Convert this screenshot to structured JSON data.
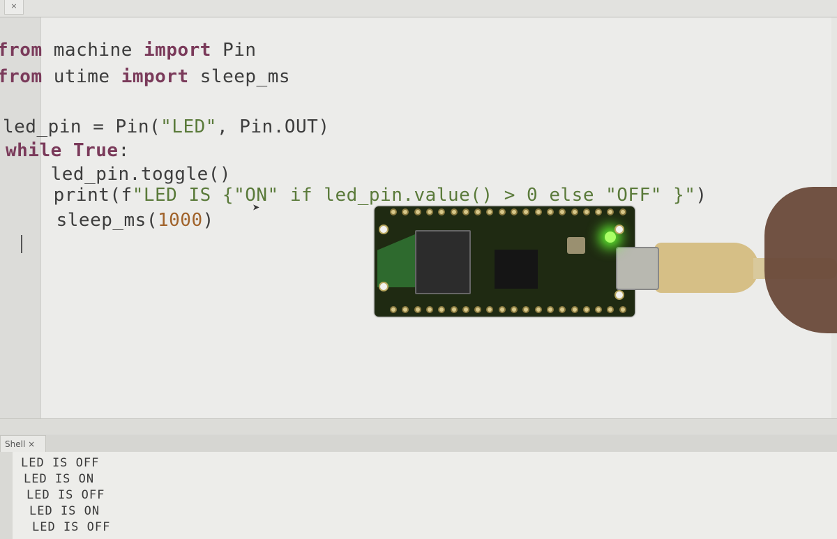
{
  "tabs": {
    "close_glyph": "×"
  },
  "editor": {
    "lines": [
      {
        "parts": [
          {
            "t": "from",
            "c": "kw"
          },
          {
            "t": " machine "
          },
          {
            "t": "import",
            "c": "kw"
          },
          {
            "t": " Pin"
          }
        ]
      },
      {
        "parts": [
          {
            "t": "from",
            "c": "kw"
          },
          {
            "t": " utime "
          },
          {
            "t": "import",
            "c": "kw"
          },
          {
            "t": " sleep_ms"
          }
        ]
      },
      {
        "parts": [
          {
            "t": ""
          }
        ]
      },
      {
        "parts": [
          {
            "t": "led_pin = Pin("
          },
          {
            "t": "\"LED\"",
            "c": "str"
          },
          {
            "t": ", Pin.OUT)"
          }
        ]
      },
      {
        "parts": [
          {
            "t": "while",
            "c": "kw"
          },
          {
            "t": " "
          },
          {
            "t": "True",
            "c": "kw"
          },
          {
            "t": ":"
          }
        ]
      },
      {
        "parts": [
          {
            "t": "    led_pin.toggle()"
          }
        ]
      },
      {
        "parts": [
          {
            "t": "    print(f"
          },
          {
            "t": "\"LED IS {\"ON\" if led_pin.value() > 0 else \"OFF\" }\"",
            "c": "str"
          },
          {
            "t": ")"
          }
        ]
      },
      {
        "parts": [
          {
            "t": "    sleep_ms("
          },
          {
            "t": "1000",
            "c": "num"
          },
          {
            "t": ")"
          }
        ]
      }
    ]
  },
  "shell": {
    "tab_label": "Shell ×",
    "output": [
      "LED IS OFF",
      "LED IS ON",
      "LED IS OFF",
      "LED IS ON",
      "LED IS OFF"
    ]
  },
  "colors": {
    "keyword": "#7a3a5a",
    "string": "#5a7a3a",
    "number": "#a0622a",
    "led_glow": "#66ff33"
  }
}
